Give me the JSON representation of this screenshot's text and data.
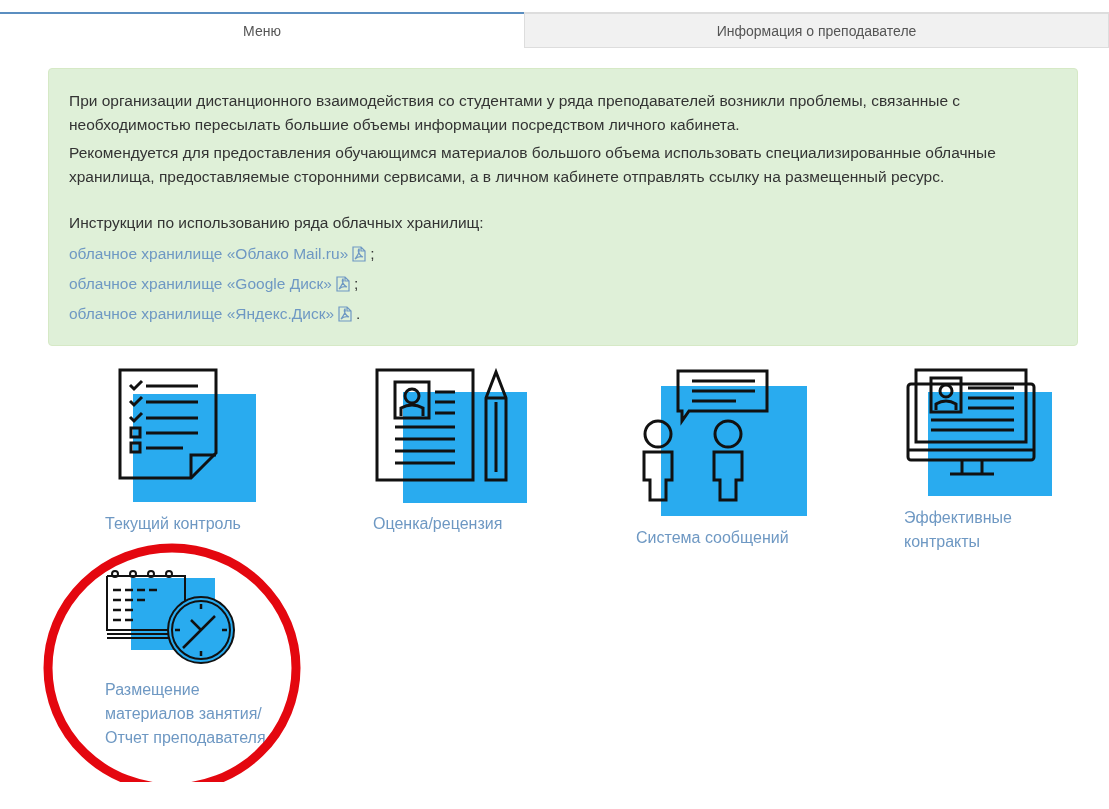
{
  "tabs": [
    {
      "label": "Меню",
      "selected": true
    },
    {
      "label": "Информация о преподавателе",
      "selected": false
    }
  ],
  "notice": {
    "paragraphs": [
      "При организации дистанционного взаимодействия со студентами у ряда преподавателей возникли проблемы, связанные с необходимостью пересылать большие объемы информации посредством личного кабинета.",
      "Рекомендуется для предоставления обучающимся материалов большого объема использовать специализированные облачные хранилища, предоставляемые сторонними сервисами, а в личном кабинете отправлять ссылку на размещенный ресурс."
    ],
    "instructions_heading": "Инструкции по использованию ряда облачных хранилищ:",
    "links": [
      {
        "text": "облачное хранилище «Облако Mail.ru»",
        "suffix": ";"
      },
      {
        "text": "облачное хранилище «Google Диск»",
        "suffix": ";"
      },
      {
        "text": "облачное хранилище «Яндекс.Диск»",
        "suffix": "."
      }
    ]
  },
  "tiles": [
    {
      "label": "Текущий контроль",
      "circled": false
    },
    {
      "label": "Оценка/рецензия",
      "circled": false
    },
    {
      "label": "Система сообщений",
      "circled": false
    },
    {
      "label": "Эффективные контракты",
      "circled": false
    },
    {
      "label": "Размещение материалов занятия/Отчет преподавателя",
      "circled": true
    }
  ]
}
